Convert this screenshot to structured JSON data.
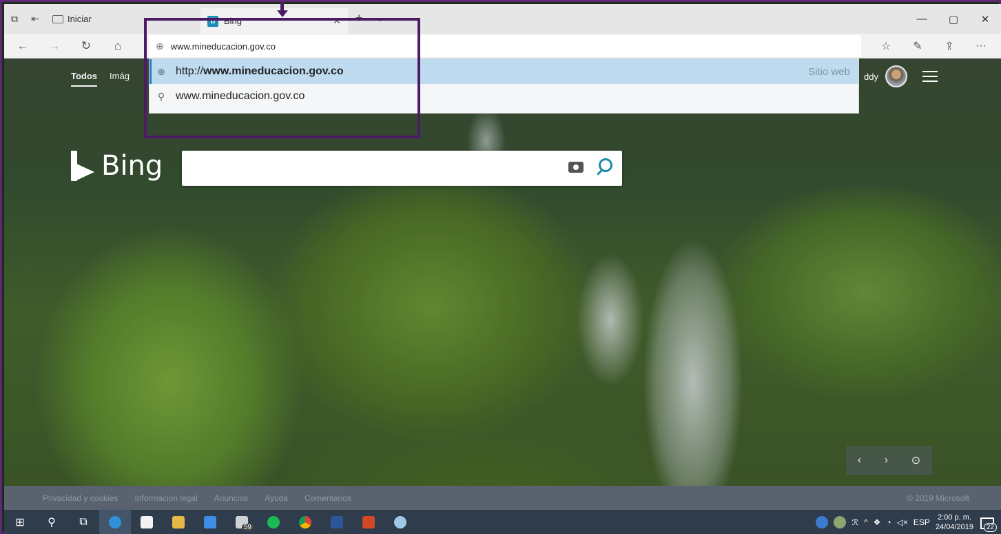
{
  "window": {
    "start_tab_label": "Iniciar",
    "active_tab_title": "Bing",
    "tab_close": "✕",
    "new_tab": "+",
    "tab_menu": "⌄",
    "win_minimize": "—",
    "win_restore": "▢",
    "win_close": "✕"
  },
  "nav": {
    "back": "←",
    "forward": "→",
    "refresh": "↻",
    "home": "⌂",
    "address_value": "www.mineducacion.gov.co",
    "favorites": "☆",
    "notes": "✎",
    "share": "⇪",
    "more": "···"
  },
  "suggestions": [
    {
      "prefix": "http://",
      "bold": "www.mineducacion.gov.co",
      "tag": "Sitio web",
      "icon": "globe-icon"
    },
    {
      "prefix": "",
      "bold": "",
      "text": "www.mineducacion.gov.co",
      "tag": "",
      "icon": "search-icon"
    }
  ],
  "page": {
    "scopes": [
      "Todos",
      "Imág"
    ],
    "user_name_fragment": "ddy",
    "logo_text": "Bing",
    "search_placeholder": "",
    "image_prev": "‹",
    "image_next": "›",
    "image_location": "⊙"
  },
  "footer": {
    "links": [
      "Privacidad y cookies",
      "Información legal",
      "Anuncios",
      "Ayuda",
      "Comentarios"
    ],
    "copyright": "© 2019 Microsoft"
  },
  "taskbar": {
    "mail_badge": "59",
    "tray_lang": "ESP",
    "time": "2:00 p. m.",
    "date": "24/04/2019",
    "notifications_count": "22",
    "tray_caret": "^"
  },
  "colors": {
    "annotation": "#4b1c63",
    "highlight": "#bedbf0",
    "taskbar": "#2f3c4c"
  }
}
